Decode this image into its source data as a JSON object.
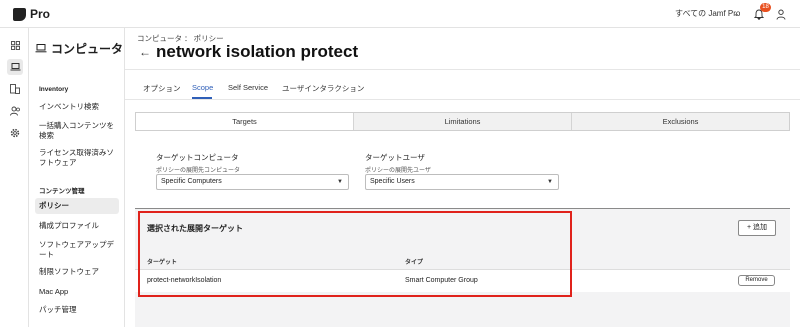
{
  "app": {
    "name": "Pro",
    "org_selector": "すべての Jamf Pro",
    "notification_count": "18"
  },
  "rail": {
    "icons": [
      "grid-icon",
      "laptop-icon",
      "devices-icon",
      "users-icon",
      "settings-icon"
    ]
  },
  "sidebar": {
    "title": "コンピュータ",
    "sections": [
      {
        "label": "Inventory",
        "items": [
          "インベントリ検索",
          "一括購入コンテンツを検索",
          "ライセンス取得済みソフトウェア"
        ]
      },
      {
        "label": "コンテンツ管理",
        "items": [
          "ポリシー",
          "構成プロファイル",
          "ソフトウェアアップデート",
          "制限ソフトウェア",
          "Mac App",
          "パッチ管理"
        ]
      }
    ],
    "active_item": "ポリシー"
  },
  "header": {
    "breadcrumb": "コンピュータ ： ポリシー",
    "title": "network isolation protect"
  },
  "tabs": [
    {
      "label": "オプション",
      "active": false
    },
    {
      "label": "Scope",
      "active": true
    },
    {
      "label": "Self Service",
      "active": false
    },
    {
      "label": "ユーザインタラクション",
      "active": false
    }
  ],
  "segments": [
    "Targets",
    "Limitations",
    "Exclusions"
  ],
  "target_computers": {
    "label": "ターゲットコンピュータ",
    "sublabel": "ポリシーの展開先コンピュータ",
    "value": "Specific Computers"
  },
  "target_users": {
    "label": "ターゲットユーザ",
    "sublabel": "ポリシーの展開先ユーザ",
    "value": "Specific Users"
  },
  "selected_targets": {
    "title": "選択された展開ターゲット",
    "add_label": "追加",
    "columns": [
      "ターゲット",
      "タイプ"
    ],
    "rows": [
      {
        "target": "protect-networkIsolation",
        "type": "Smart Computer Group",
        "action": "Remove"
      }
    ]
  },
  "colors": {
    "accent": "#2f5fb8",
    "badge": "#e8501f",
    "highlight": "#e0221b"
  }
}
